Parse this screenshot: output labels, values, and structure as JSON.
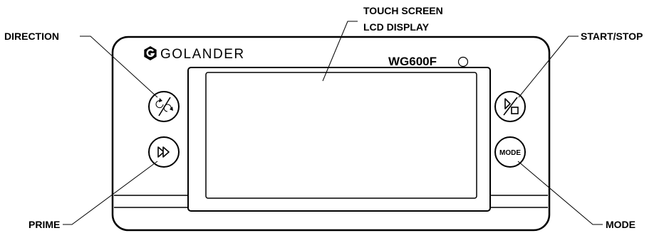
{
  "device": {
    "brand": "GOLANDER",
    "model": "WG600F",
    "mode_button_text": "MODE"
  },
  "callouts": {
    "direction": "DIRECTION",
    "prime": "PRIME",
    "touch_screen_line1": "TOUCH SCREEN",
    "touch_screen_line2": "LCD DISPLAY",
    "start_stop": "START/STOP",
    "mode": "MODE"
  },
  "icons": {
    "logo": "golander-logo-icon",
    "direction": "direction-rotate-icon",
    "prime": "fast-forward-icon",
    "start_stop": "play-stop-icon",
    "indicator": "indicator-led-icon"
  }
}
